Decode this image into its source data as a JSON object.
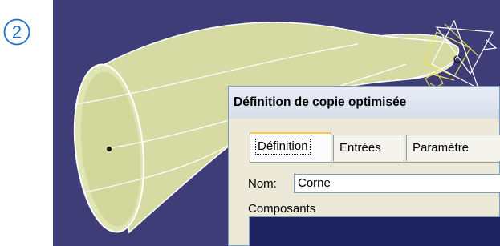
{
  "step_marker": {
    "number": "2"
  },
  "dialog": {
    "title": "Définition de copie optimisée",
    "tabs": [
      {
        "label": "Définition",
        "active": true
      },
      {
        "label": "Entrées",
        "active": false
      },
      {
        "label": "Paramètre",
        "active": false
      }
    ],
    "name_label": "Nom:",
    "name_value": "Corne",
    "components_label": "Composants"
  },
  "colors": {
    "viewport_background": "#3e3d77",
    "surface_fill": "#d6dca6",
    "tab_highlight": "#ffc83c"
  }
}
